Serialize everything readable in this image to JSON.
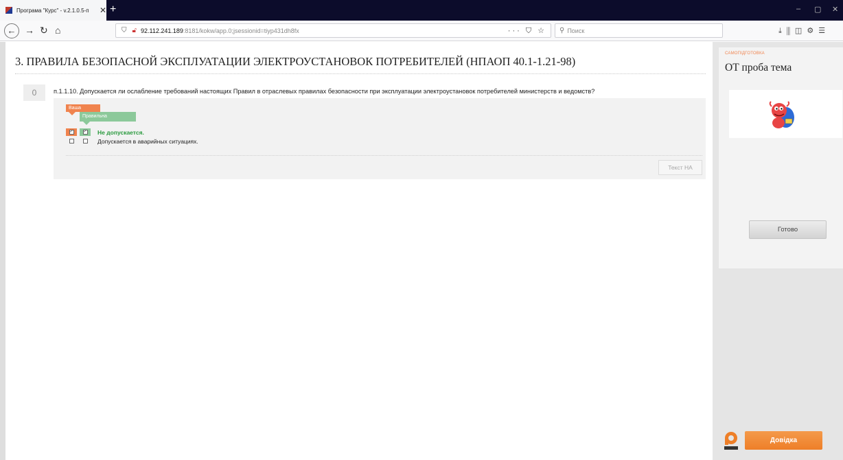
{
  "browser": {
    "tab_title": "Програма \"Курс\" - v.2.1.0.5-п",
    "tab_close": "✕",
    "new_tab": "+",
    "url_host": "92.112.241.189",
    "url_rest": ":8181/kokw/app.0;jsessionid=tiyp431dh8fx",
    "url_actions": "··· ⛉ ☆",
    "search_placeholder": "Поиск",
    "win_min": "–",
    "win_max": "▢",
    "win_close": "✕"
  },
  "page": {
    "heading": "3. ПРАВИЛА БЕЗОПАСНОЙ ЭКСПЛУАТАЦИИ ЭЛЕКТРОУСТАНОВОК ПОТРЕБИТЕЛЕЙ (НПАОП 40.1-1.21-98)",
    "question_number": "0",
    "question_text": "п.1.1.10. Допускается ли ослабление требований настоящих Правил в отраслевых правилах безопасности при эксплуатации электроустановок потребителей министерств и ведомств?",
    "legend_yours": "Ваша",
    "legend_correct": "Правильна",
    "answers": [
      {
        "text": "Не допускается.",
        "yours_checked": true,
        "correct_checked": true
      },
      {
        "text": "Допускается в аварийных ситуациях.",
        "yours_checked": false,
        "correct_checked": false
      }
    ],
    "check_mark": "✓",
    "text_na_button": "Текст НА"
  },
  "sidebar": {
    "label": "САМОПІДГОТОВКА",
    "title": "ОТ проба тема",
    "done_button": "Готово",
    "help_button": "Довідка"
  },
  "colors": {
    "yours": "#f0834e",
    "correct": "#8cc99a",
    "correct_text": "#2a9a3e",
    "help_button": "#ee7f28"
  }
}
